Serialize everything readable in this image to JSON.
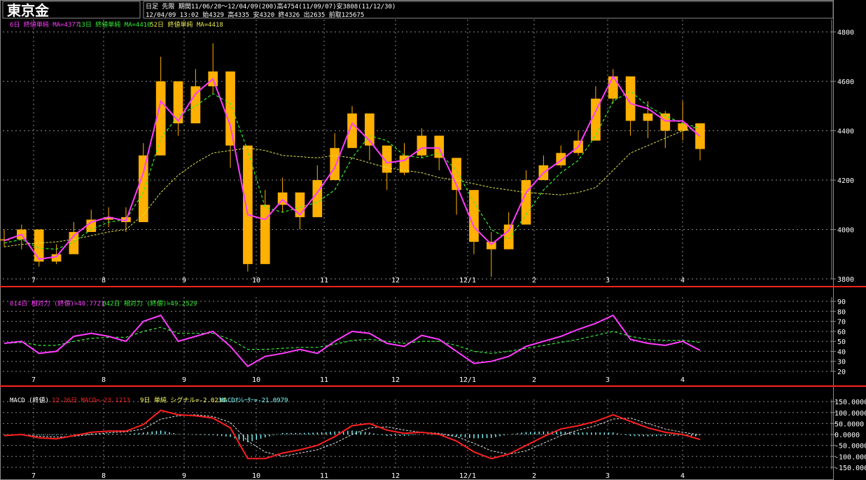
{
  "header": {
    "title": "東京金",
    "line1": "日足 先限 期間11/06/20〜12/04/09(200)高4754(11/09/07)安3808(11/12/30)",
    "line2": "12/04/09 13:02 始4329 高4335 安4320 終4326 出2635 前取125675"
  },
  "colors": {
    "background": "#000000",
    "grid": "#8a8a8a",
    "candle": "#ffb000",
    "ma_short": "#ff3cff",
    "ma_mid": "#33ee33",
    "ma_long": "#e6e64a",
    "rsi_short": "#ff3cff",
    "rsi_long": "#33ee33",
    "macd": "#ff2020",
    "signal": "#e0e0e0",
    "histogram": "#7fffff",
    "separator": "#ff2020"
  },
  "price_panel": {
    "legend": [
      {
        "text": "6日 終値単純 MA=4377",
        "color": "#ff3cff"
      },
      {
        "text": "13日 終値単純 MA=4410",
        "color": "#33ee33"
      },
      {
        "text": "52日 終値単純 MA=4418",
        "color": "#e6e64a"
      }
    ],
    "y_ticks": [
      "4800",
      "4600",
      "4400",
      "4200",
      "4000",
      "3800"
    ]
  },
  "rsi_panel": {
    "legend": [
      {
        "text": "014日 相対力 (終値)=40.7721",
        "color": "#ff3cff"
      },
      {
        "text": "042日 相対力 (終値)=49.2529",
        "color": "#33ee33"
      }
    ],
    "y_ticks": [
      "90",
      "80",
      "70",
      "60",
      "50",
      "40",
      "30",
      "20"
    ]
  },
  "macd_panel": {
    "legend": [
      {
        "text": "MACD (終値)",
        "color": "#ffffff"
      },
      {
        "text": "12-26日 MACD=-23.1213",
        "color": "#ff2020"
      },
      {
        "text": "9日 単純 シグナル=-2.0234",
        "color": "#ffff66"
      },
      {
        "text": "MACDｵｼﾚｰﾀｰ=-21.0979",
        "color": "#7fffff"
      }
    ],
    "y_ticks": [
      "150.0000",
      "100.0000",
      "50.0000",
      "0.0000",
      "-50.0000",
      "-100.0000",
      "-150.0000"
    ]
  },
  "x_axis_labels": [
    "7",
    "8",
    "9",
    "10",
    "11",
    "12",
    "12/1",
    "2",
    "3",
    "4"
  ],
  "chart_data": [
    {
      "type": "line",
      "title": "東京金",
      "x_labels": [
        "7",
        "8",
        "9",
        "10",
        "11",
        "12",
        "12/1",
        "2",
        "3",
        "4"
      ],
      "ylim": [
        3800,
        4850
      ],
      "ticks": [
        4800,
        4600,
        4400,
        4200,
        4000,
        3800
      ],
      "grid": true,
      "series": [
        {
          "name": "6日 終値単純 MA",
          "values": [
            3955,
            3980,
            3880,
            3890,
            3975,
            4030,
            4050,
            4035,
            4230,
            4520,
            4440,
            4550,
            4610,
            4420,
            4060,
            4040,
            4120,
            4060,
            4150,
            4250,
            4430,
            4360,
            4270,
            4280,
            4330,
            4330,
            4180,
            4010,
            3940,
            3995,
            4150,
            4230,
            4280,
            4335,
            4480,
            4620,
            4510,
            4490,
            4440,
            4440,
            4377
          ]
        },
        {
          "name": "13日 終値単純 MA",
          "values": [
            3945,
            3960,
            3925,
            3920,
            3950,
            4000,
            4030,
            4040,
            4150,
            4370,
            4460,
            4500,
            4550,
            4510,
            4320,
            4090,
            4070,
            4090,
            4110,
            4160,
            4290,
            4380,
            4360,
            4300,
            4290,
            4310,
            4240,
            4110,
            4000,
            3960,
            4060,
            4160,
            4230,
            4280,
            4380,
            4520,
            4560,
            4500,
            4460,
            4430,
            4410
          ]
        },
        {
          "name": "52日 終値単純 MA",
          "values": [
            3930,
            3940,
            3945,
            3950,
            3960,
            3975,
            3990,
            4000,
            4060,
            4150,
            4220,
            4270,
            4310,
            4320,
            4330,
            4320,
            4300,
            4295,
            4290,
            4300,
            4290,
            4270,
            4250,
            4240,
            4230,
            4210,
            4200,
            4185,
            4170,
            4160,
            4150,
            4145,
            4140,
            4150,
            4170,
            4240,
            4310,
            4340,
            4370,
            4400,
            4418
          ]
        },
        {
          "name": "candle_close",
          "values": [
            3960,
            4000,
            3870,
            3900,
            3990,
            4040,
            4050,
            4030,
            4300,
            4600,
            4430,
            4580,
            4640,
            4340,
            3860,
            4100,
            4150,
            4050,
            4200,
            4330,
            4470,
            4340,
            4230,
            4300,
            4380,
            4290,
            4160,
            3950,
            3920,
            4020,
            4200,
            4260,
            4310,
            4360,
            4530,
            4620,
            4440,
            4470,
            4400,
            4430,
            4326
          ]
        },
        {
          "name": "candle_high",
          "values": [
            4000,
            4020,
            3910,
            3940,
            4030,
            4080,
            4090,
            4090,
            4350,
            4700,
            4520,
            4650,
            4754,
            4450,
            4200,
            4160,
            4210,
            4120,
            4260,
            4390,
            4500,
            4420,
            4300,
            4350,
            4410,
            4380,
            4230,
            4100,
            3990,
            4070,
            4240,
            4300,
            4340,
            4400,
            4580,
            4650,
            4560,
            4520,
            4480,
            4520,
            4360
          ]
        },
        {
          "name": "candle_low",
          "values": [
            3930,
            3920,
            3850,
            3860,
            3950,
            4000,
            4010,
            3990,
            4160,
            4420,
            4380,
            4450,
            4550,
            4250,
            3830,
            3960,
            4070,
            4000,
            4120,
            4230,
            4380,
            4280,
            4160,
            4220,
            4290,
            4240,
            4060,
            3900,
            3808,
            3950,
            4130,
            4200,
            4250,
            4300,
            4430,
            4510,
            4380,
            4370,
            4330,
            4360,
            4280
          ]
        }
      ]
    },
    {
      "type": "line",
      "title": "相対力",
      "ylim": [
        20,
        90
      ],
      "series": [
        {
          "name": "014日 相対力 (終値)",
          "values": [
            48,
            50,
            38,
            40,
            55,
            58,
            55,
            50,
            70,
            76,
            50,
            55,
            60,
            45,
            25,
            35,
            38,
            42,
            38,
            50,
            60,
            58,
            48,
            45,
            56,
            52,
            40,
            28,
            30,
            35,
            45,
            50,
            55,
            62,
            68,
            76,
            52,
            48,
            46,
            50,
            41
          ]
        },
        {
          "name": "042日 相対力 (終値)",
          "values": [
            48,
            49,
            46,
            46,
            50,
            53,
            54,
            54,
            60,
            64,
            58,
            58,
            58,
            52,
            42,
            42,
            43,
            44,
            44,
            47,
            51,
            52,
            50,
            48,
            50,
            50,
            46,
            40,
            38,
            40,
            43,
            46,
            49,
            52,
            56,
            60,
            55,
            52,
            51,
            51,
            49
          ]
        }
      ]
    },
    {
      "type": "line",
      "title": "MACD (終値)",
      "ylim": [
        -160,
        160
      ],
      "series": [
        {
          "name": "12-26日 MACD",
          "values": [
            -5,
            0,
            -15,
            -20,
            -5,
            10,
            15,
            15,
            45,
            110,
            90,
            85,
            75,
            30,
            -110,
            -110,
            -85,
            -70,
            -50,
            -10,
            40,
            50,
            20,
            5,
            10,
            0,
            -30,
            -80,
            -110,
            -90,
            -50,
            -10,
            25,
            40,
            60,
            90,
            60,
            30,
            10,
            0,
            -23
          ]
        },
        {
          "name": "9日 単純 シグナル",
          "values": [
            -3,
            -2,
            -8,
            -12,
            -8,
            0,
            8,
            12,
            25,
            70,
            85,
            90,
            82,
            55,
            -30,
            -80,
            -100,
            -85,
            -70,
            -40,
            0,
            30,
            35,
            20,
            10,
            5,
            -10,
            -40,
            -75,
            -90,
            -75,
            -40,
            -5,
            20,
            40,
            70,
            75,
            50,
            25,
            10,
            -2
          ]
        }
      ]
    }
  ]
}
